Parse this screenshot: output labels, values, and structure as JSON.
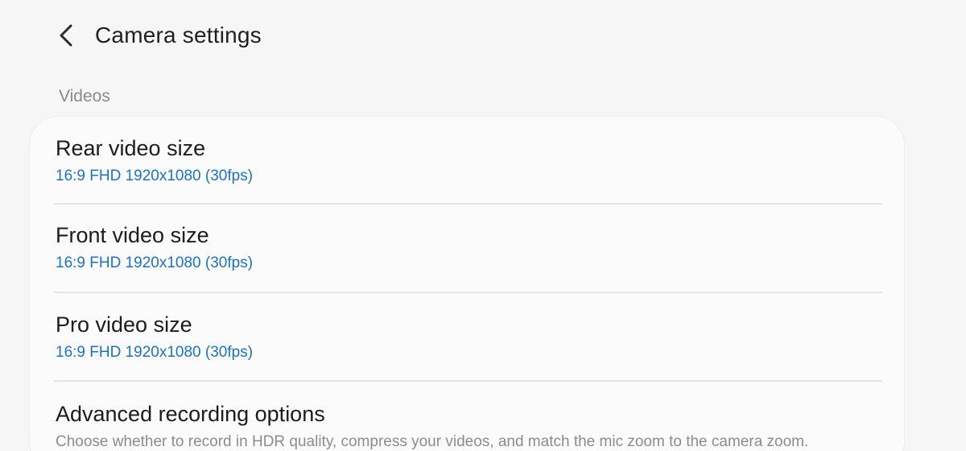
{
  "header": {
    "back_icon": "chevron-left-icon",
    "title": "Camera settings"
  },
  "section": {
    "title": "Videos"
  },
  "items": [
    {
      "title": "Rear video size",
      "value": "16:9 FHD 1920x1080 (30fps)"
    },
    {
      "title": "Front video size",
      "value": "16:9 FHD 1920x1080 (30fps)"
    },
    {
      "title": "Pro video size",
      "value": "16:9 FHD 1920x1080 (30fps)"
    },
    {
      "title": "Advanced recording options",
      "description": "Choose whether to record in HDR quality, compress your videos, and match the mic zoom to the camera zoom."
    }
  ],
  "colors": {
    "accent": "#1a73c9",
    "background": "#f6f6f6",
    "card": "#fbfbfb"
  }
}
